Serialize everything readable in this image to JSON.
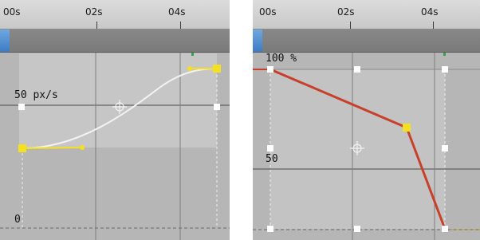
{
  "left_panel": {
    "ruler": {
      "ticks": [
        "00s",
        "02s",
        "04s"
      ]
    },
    "labels": {
      "speed": "50 px/s",
      "zero": "0"
    }
  },
  "right_panel": {
    "ruler": {
      "ticks": [
        "00s",
        "02s",
        "04s"
      ]
    },
    "labels": {
      "top": "100 %",
      "mid": "50"
    }
  },
  "colors": {
    "panel_bg": "#b6b6b6",
    "curve_white": "#f2f2f2",
    "keyframe_yellow": "#f5e020",
    "graph_red": "#c8402a",
    "handle_white": "#ffffff",
    "timeline_blue": "#3d7cc4"
  },
  "icons": [
    "crosshair-icon",
    "keyframe-handle-icon",
    "playhead-marker-icon"
  ]
}
